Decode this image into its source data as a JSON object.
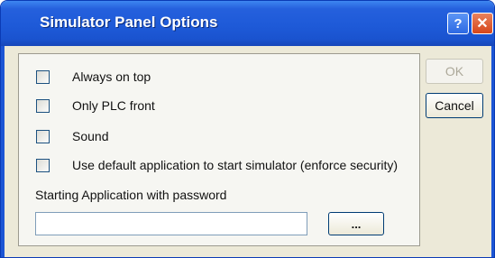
{
  "window": {
    "title": "Simulator Panel Options",
    "help_label": "?",
    "close_label": "✕"
  },
  "options": [
    {
      "label": "Always on top",
      "checked": false
    },
    {
      "label": "Only PLC front",
      "checked": false
    },
    {
      "label": "Sound",
      "checked": false
    },
    {
      "label": "Use default application to start simulator (enforce security)",
      "checked": false
    }
  ],
  "password": {
    "label": "Starting Application with password",
    "value": "",
    "browse_label": "..."
  },
  "buttons": {
    "ok_label": "OK",
    "cancel_label": "Cancel"
  },
  "colors": {
    "titlebar": "#1e5ad8",
    "dialog_bg": "#ece9d8",
    "close_button": "#d6461b"
  }
}
